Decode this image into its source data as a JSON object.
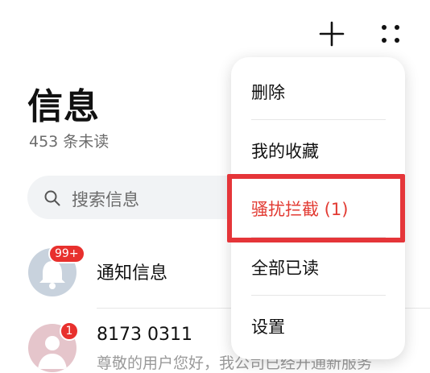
{
  "header": {
    "title": "信息",
    "unread": "453 条未读",
    "add_icon": "plus-icon",
    "more_icon": "more-dots-icon"
  },
  "search": {
    "placeholder": "搜索信息",
    "icon": "search-icon"
  },
  "conversations": [
    {
      "name": "通知信息",
      "badge": "99+",
      "avatar": "bell-icon"
    },
    {
      "name": "8173 0311",
      "badge": "1",
      "avatar": "person-icon",
      "preview": "尊敬的用户您好，我公司已经开通新服务"
    }
  ],
  "menu": {
    "items": [
      {
        "label": "删除"
      },
      {
        "label": "我的收藏"
      },
      {
        "label": "骚扰拦截 (1)"
      },
      {
        "label": "全部已读"
      },
      {
        "label": "设置"
      }
    ]
  },
  "colors": {
    "highlight": "#e53539",
    "active_item": "#e23b33",
    "badge": "#e8302d"
  }
}
